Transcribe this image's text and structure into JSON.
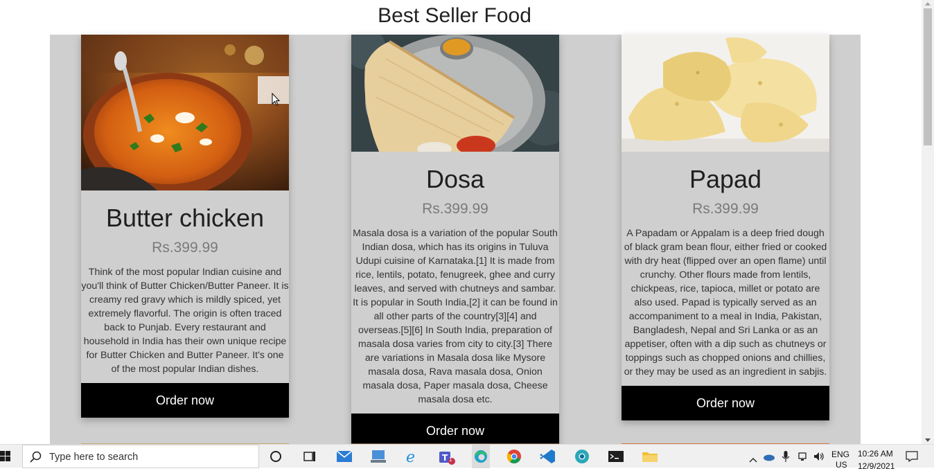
{
  "page": {
    "title": "Best Seller Food"
  },
  "cards": [
    {
      "name": "Butter chicken",
      "price": "Rs.399.99",
      "description": "Think of the most popular Indian cuisine and you'll think of Butter Chicken/Butter Paneer. It is creamy red gravy which is mildly spiced, yet extremely flavorful. The origin is often traced back to Punjab. Every restaurant and household in India has their own unique recipe for Butter Chicken and Butter Paneer. It's one of the most popular Indian dishes.",
      "button": "Order now"
    },
    {
      "name": "Dosa",
      "price": "Rs.399.99",
      "description": "Masala dosa is a variation of the popular South Indian dosa, which has its origins in Tuluva Udupi cuisine of Karnataka.[1] It is made from rice, lentils, potato, fenugreek, ghee and curry leaves, and served with chutneys and sambar. It is popular in South India,[2] it can be found in all other parts of the country[3][4] and overseas.[5][6] In South India, preparation of masala dosa varies from city to city.[3] There are variations in Masala dosa like Mysore masala dosa, Rava masala dosa, Onion masala dosa, Paper masala dosa, Cheese masala dosa etc.",
      "button": "Order now"
    },
    {
      "name": "Papad",
      "price": "Rs.399.99",
      "description": "A Papadam or Appalam is a deep fried dough of black gram bean flour, either fried or cooked with dry heat (flipped over an open flame) until crunchy. Other flours made from lentils, chickpeas, rice, tapioca, millet or potato are also used. Papad is typically served as an accompaniment to a meal in India, Pakistan, Bangladesh, Nepal and Sri Lanka or as an appetiser, often with a dip such as chutneys or toppings such as chopped onions and chillies, or they may be used as an ingredient in sabjis.",
      "button": "Order now"
    }
  ],
  "taskbar": {
    "search_placeholder": "Type here to search",
    "apps": [
      "cortana-icon",
      "task-view-icon",
      "mail-icon",
      "network-drive-icon",
      "internet-explorer-icon",
      "teams-icon",
      "edge-icon",
      "chrome-icon",
      "vscode-icon",
      "chrome-canary-icon",
      "terminal-icon",
      "file-explorer-icon"
    ],
    "lang_top": "ENG",
    "lang_bottom": "US",
    "time": "10:26 AM",
    "date": "12/9/2021",
    "teams_badge": "1"
  },
  "colors": {
    "band": "#cfcfcf",
    "button": "#000000",
    "price": "#7a7a7a"
  }
}
